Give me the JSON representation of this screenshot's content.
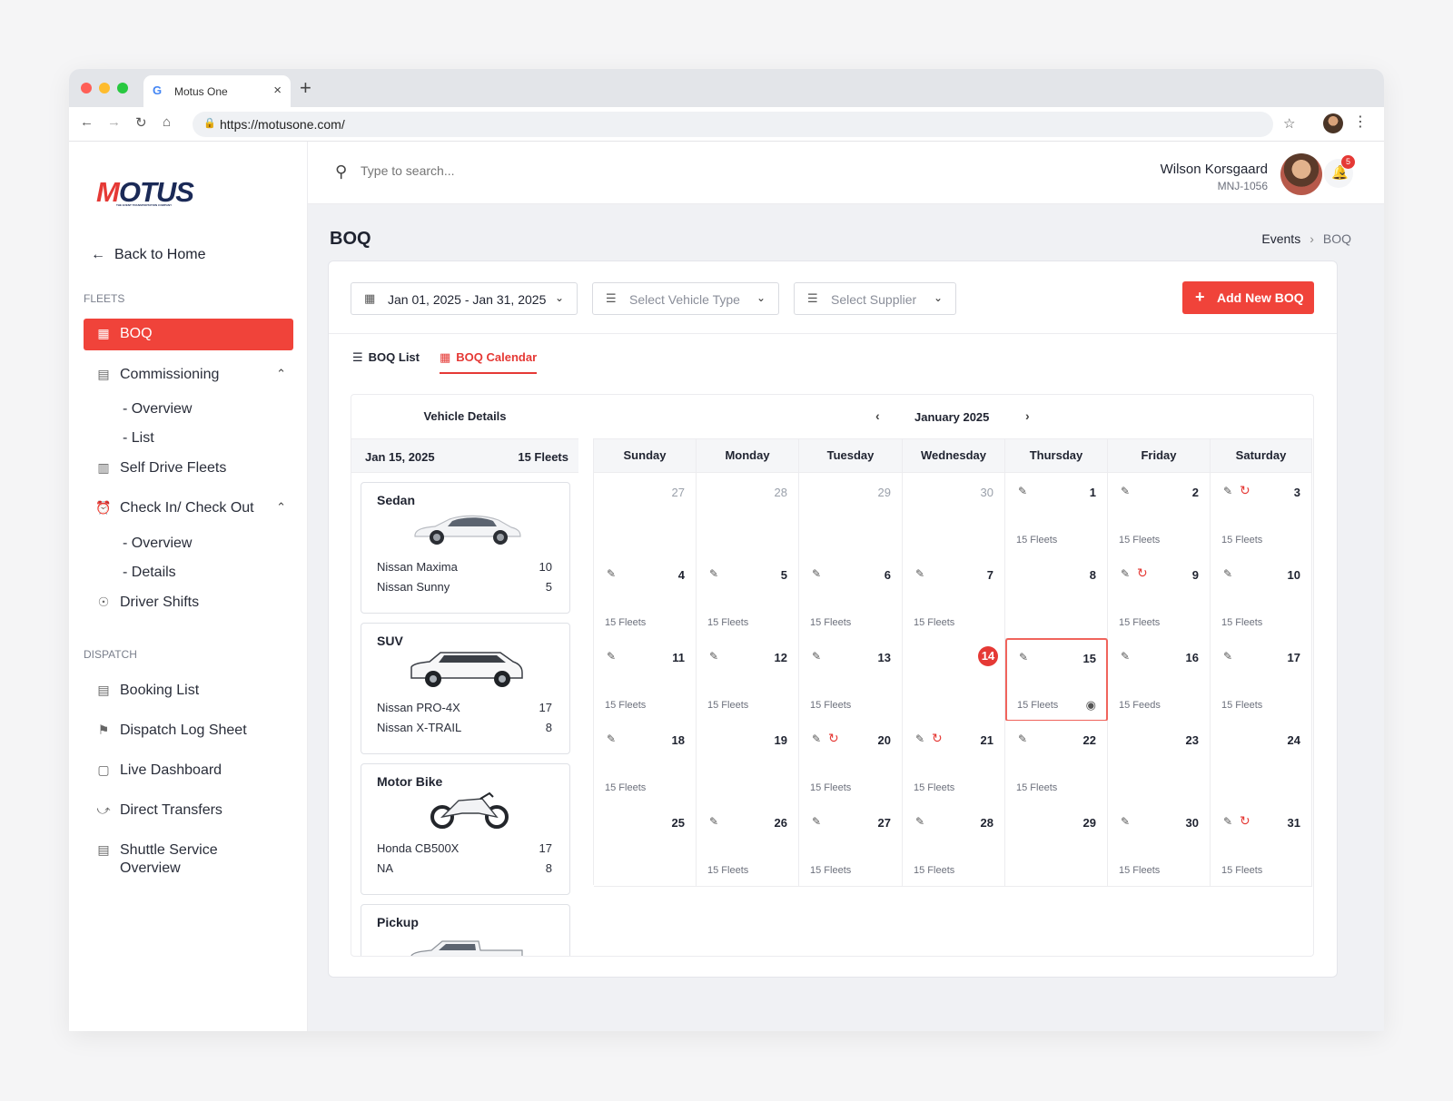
{
  "browser": {
    "tab_title": "Motus One",
    "tab_close": "×",
    "new_tab": "+",
    "url": "https://motusone.com/",
    "google_g": "G"
  },
  "sidebar": {
    "logo_prefix": "M",
    "logo_rest": "OTUS",
    "logo_tagline": "THE EVENT TRANSPORTATION COMPANY",
    "back_label": "Back to Home",
    "fleets_section": "FLEETS",
    "dispatch_section": "DISPATCH",
    "items": [
      {
        "label": "BOQ",
        "icon": "grid-icon"
      },
      {
        "label": "Commissioning",
        "icon": "clipboard-icon"
      },
      {
        "label": "Self Drive Fleets",
        "icon": "building-icon"
      },
      {
        "label": "Check In/ Check Out",
        "icon": "alarm-clock-icon"
      },
      {
        "label": "Driver Shifts",
        "icon": "steering-wheel-icon"
      },
      {
        "label": "Booking List",
        "icon": "document-icon"
      },
      {
        "label": "Dispatch Log Sheet",
        "icon": "flag-icon"
      },
      {
        "label": "Live Dashboard",
        "icon": "dashboard-icon"
      },
      {
        "label": "Direct Transfers",
        "icon": "route-icon"
      },
      {
        "label": "Shuttle Service",
        "label2": "Overview",
        "icon": "shuttle-icon"
      }
    ],
    "commissioning_sub": [
      "- Overview",
      "- List"
    ],
    "checkin_sub": [
      "- Overview",
      "- Details"
    ]
  },
  "header": {
    "search_placeholder": "Type to search...",
    "messages_badge": "5",
    "notifications_badge": "5",
    "user_name": "Wilson Korsgaard",
    "user_id": "MNJ-1056"
  },
  "page": {
    "title": "BOQ",
    "breadcrumb": [
      "Events",
      "BOQ"
    ]
  },
  "filters": {
    "date_range": "Jan 01, 2025 - Jan 31, 2025",
    "vehicle_type_placeholder": "Select Vehicle Type",
    "supplier_placeholder": "Select Supplier",
    "add_button": "Add New BOQ"
  },
  "view_tabs": {
    "list": "BOQ List",
    "calendar": "BOQ Calendar",
    "active": "calendar"
  },
  "vehicle_panel": {
    "header": "Vehicle Details",
    "date": "Jan 15, 2025",
    "fleets": "15 Fleets",
    "vehicles": [
      {
        "type": "Sedan",
        "rows": [
          {
            "name": "Nissan Maxima",
            "count": "10"
          },
          {
            "name": "Nissan Sunny",
            "count": "5"
          }
        ]
      },
      {
        "type": "SUV",
        "rows": [
          {
            "name": "Nissan PRO-4X",
            "count": "17"
          },
          {
            "name": "Nissan X-TRAIL",
            "count": "8"
          }
        ]
      },
      {
        "type": "Motor Bike",
        "rows": [
          {
            "name": "Honda CB500X",
            "count": "17"
          },
          {
            "name": "NA",
            "count": "8"
          }
        ]
      },
      {
        "type": "Pickup",
        "rows": []
      }
    ]
  },
  "calendar": {
    "month": "January 2025",
    "weekdays": [
      "Sunday",
      "Monday",
      "Tuesday",
      "Wednesday",
      "Thursday",
      "Friday",
      "Saturday"
    ],
    "today": "14",
    "selected": "15",
    "cells": [
      {
        "d": "27",
        "other": true
      },
      {
        "d": "28",
        "other": true
      },
      {
        "d": "29",
        "other": true
      },
      {
        "d": "30",
        "other": true
      },
      {
        "d": "1",
        "edit": true,
        "f": "15 Fleets"
      },
      {
        "d": "2",
        "edit": true,
        "f": "15 Fleets"
      },
      {
        "d": "3",
        "edit": true,
        "sync": true,
        "f": "15 Fleets"
      },
      {
        "d": "4",
        "edit": true,
        "f": "15 Fleets"
      },
      {
        "d": "5",
        "edit": true,
        "f": "15 Fleets"
      },
      {
        "d": "6",
        "edit": true,
        "f": "15 Fleets"
      },
      {
        "d": "7",
        "edit": true,
        "f": "15 Fleets"
      },
      {
        "d": "8"
      },
      {
        "d": "9",
        "edit": true,
        "sync": true,
        "f": "15 Fleets"
      },
      {
        "d": "10",
        "edit": true,
        "f": "15 Fleets"
      },
      {
        "d": "11",
        "edit": true,
        "f": "15 Fleets"
      },
      {
        "d": "12",
        "edit": true,
        "f": "15 Fleets"
      },
      {
        "d": "13",
        "edit": true,
        "f": "15 Fleets"
      },
      {
        "d": "14",
        "today": true
      },
      {
        "d": "15",
        "edit": true,
        "f": "15 Fleets",
        "view": true,
        "selected": true
      },
      {
        "d": "16",
        "edit": true,
        "f": "15 Feeds"
      },
      {
        "d": "17",
        "edit": true,
        "f": "15 Fleets"
      },
      {
        "d": "18",
        "edit": true,
        "f": "15 Fleets"
      },
      {
        "d": "19"
      },
      {
        "d": "20",
        "edit": true,
        "sync": true,
        "f": "15 Fleets"
      },
      {
        "d": "21",
        "edit": true,
        "sync": true,
        "f": "15 Fleets"
      },
      {
        "d": "22",
        "edit": true,
        "f": "15 Fleets"
      },
      {
        "d": "23"
      },
      {
        "d": "24"
      },
      {
        "d": "25"
      },
      {
        "d": "26",
        "edit": true,
        "f": "15 Fleets"
      },
      {
        "d": "27",
        "edit": true,
        "f": "15 Fleets"
      },
      {
        "d": "28",
        "edit": true,
        "f": "15 Fleets"
      },
      {
        "d": "29"
      },
      {
        "d": "30",
        "edit": true,
        "f": "15 Fleets"
      },
      {
        "d": "31",
        "edit": true,
        "sync": true,
        "f": "15 Fleets"
      }
    ]
  },
  "colors": {
    "accent": "#f0433a",
    "brand_navy": "#1b2a57"
  }
}
